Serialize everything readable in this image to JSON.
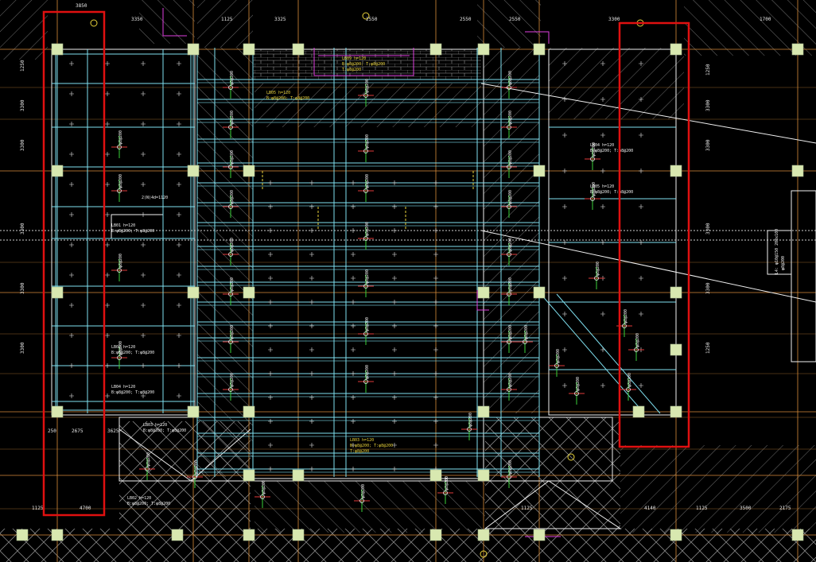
{
  "canvas": {
    "background": "#000000"
  },
  "colors": {
    "column_fill": "#d8e8b0",
    "beam_cyan": "#7fe0f0",
    "beam_white": "#f0f0f0",
    "grid_orange": "#d98c3a",
    "rebar_green": "#3ad23a",
    "rebar_red": "#e03a3a",
    "magenta": "#e040e0",
    "yellow": "#e8d23a",
    "hatch_gray": "#8a8a8a",
    "highlight_red": "#e01010"
  },
  "dimensions": {
    "top_left": "3850",
    "top_row": [
      "3350",
      "1125",
      "3325",
      "2550",
      "2550",
      "2550",
      "3300",
      "1700"
    ],
    "bottom_left": [
      "1125",
      "4700"
    ],
    "bottom_left_sub": [
      "250",
      "2675",
      "3625"
    ],
    "bottom_right": [
      "1125",
      "4140",
      "1125",
      "3500",
      "2175"
    ],
    "left_col": [
      "1250",
      "3300",
      "3300",
      "3300",
      "3300",
      "3300"
    ],
    "right_col": [
      "1250",
      "3300",
      "3300",
      "3300",
      "3300",
      "1250"
    ]
  },
  "beam_notes": {
    "top_center": [
      "LB09  h=120",
      "B:φ8@200;  T:φ8@200",
      "T:φ8@200"
    ],
    "upper_center": [
      "LB05  h=120",
      "B:φ8@200;  T:φ8@200"
    ],
    "left_a": [
      "LB01  h=120",
      "B:φ8@200;  T:φ8@200"
    ],
    "left_b": [
      "LB02  h=120",
      "B:φ8@200;  T:φ8@200"
    ],
    "left_c": [
      "LB04  h=120",
      "B:φ8@200;  T:φ8@200"
    ],
    "left_d": [
      "LB03  h=120",
      "B:φ8@200;  T:φ8@200"
    ],
    "bottom_center": [
      "LB03  h=120",
      "B:φ8@200;  T:φ8@200",
      "T:φ8@200"
    ],
    "bottom_left": [
      "LB02  h=120",
      "B:φ8@200;  T:φ8@200"
    ],
    "right_a": [
      "LB04  h=120",
      "B:φ8@200;  T:φ8@200"
    ],
    "right_b": [
      "LB05  h=120",
      "B:φ8@200;  T:φ8@200"
    ],
    "far_right": [
      "L4: φ10@150  200x100",
      "φ8@200"
    ],
    "left_stair": "2(N)4d=1120"
  },
  "rebar_label": "φ8@200"
}
